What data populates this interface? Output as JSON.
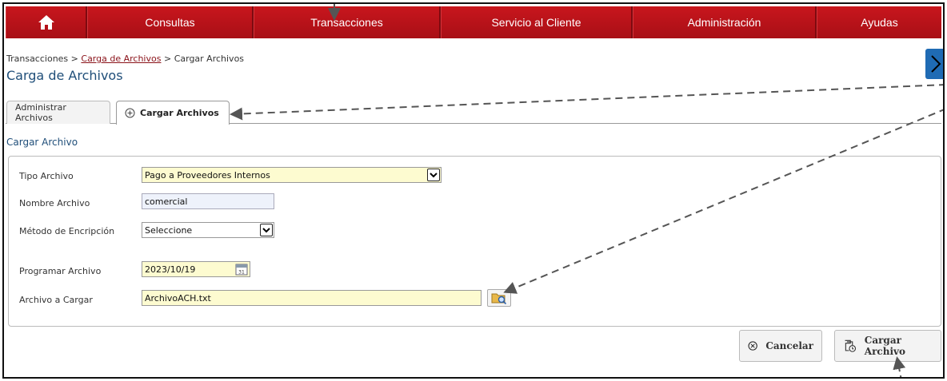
{
  "nav": {
    "home_icon": "home-icon",
    "items": [
      "Consultas",
      "Transacciones",
      "Servicio al Cliente",
      "Administración",
      "Ayudas"
    ]
  },
  "breadcrumb": {
    "root": "Transacciones",
    "sep1": " > ",
    "link": "Carga de Archivos",
    "sep2": " > ",
    "current": "Cargar Archivos"
  },
  "page_title": "Carga de Archivos",
  "tabs": {
    "administrar": "Administrar Archivos",
    "cargar": "Cargar Archivos"
  },
  "section_title": "Cargar Archivo",
  "form": {
    "tipo_label": "Tipo Archivo",
    "tipo_value": "Pago a Proveedores Internos",
    "nombre_label": "Nombre Archivo",
    "nombre_value": "comercial",
    "metodo_label": "Método de Encripción",
    "metodo_value": "Seleccione",
    "programar_label": "Programar Archivo",
    "programar_value": "2023/10/19",
    "archivo_label": "Archivo a Cargar",
    "archivo_value": "ArchivoACH.txt"
  },
  "buttons": {
    "cancelar": "Cancelar",
    "cargar": "Cargar Archivo"
  },
  "colors": {
    "nav_red": "#b5121b",
    "title_blue": "#1f4e79",
    "field_yellow": "#fdfbd0"
  }
}
